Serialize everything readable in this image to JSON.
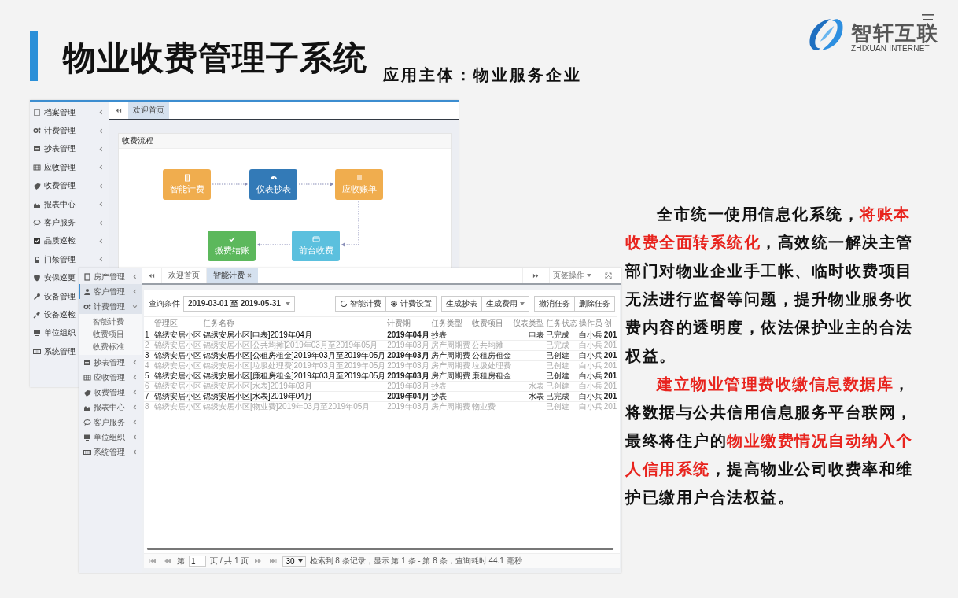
{
  "slide": {
    "title": "物业收费管理子系统",
    "subtitle": "应用主体：物业服务企业"
  },
  "logo": {
    "name": "智轩互联",
    "tagline": "ZHIXUAN INTERNET"
  },
  "screenshot_1": {
    "sidebar": [
      {
        "label": "档案管理",
        "chevron": true
      },
      {
        "label": "计费管理",
        "chevron": true
      },
      {
        "label": "抄表管理",
        "chevron": true
      },
      {
        "label": "应收管理",
        "chevron": true
      },
      {
        "label": "收费管理",
        "chevron": true
      },
      {
        "label": "报表中心",
        "chevron": true
      },
      {
        "label": "客户服务",
        "chevron": true
      },
      {
        "label": "品质巡检",
        "chevron": true
      },
      {
        "label": "门禁管理",
        "chevron": true
      },
      {
        "label": "安保巡更",
        "chevron": false
      },
      {
        "label": "设备管理",
        "chevron": false
      },
      {
        "label": "设备巡检",
        "chevron": false
      },
      {
        "label": "单位组织",
        "chevron": false
      },
      {
        "label": "系统管理",
        "chevron": false
      }
    ],
    "tabs": [
      {
        "label": "欢迎首页",
        "selected": true
      }
    ],
    "panel": {
      "title": "收费流程",
      "steps": [
        {
          "label": "智能计费",
          "color": "#f0ad4e"
        },
        {
          "label": "仪表抄表",
          "color": "#337ab7"
        },
        {
          "label": "应收账单",
          "color": "#f0ad4e"
        },
        {
          "label": "前台收费",
          "color": "#5bc0de"
        },
        {
          "label": "缴费结账",
          "color": "#5cb85c"
        }
      ]
    }
  },
  "screenshot_2": {
    "sidebar": [
      {
        "label": "房产管理",
        "selected": false,
        "expanded": false
      },
      {
        "label": "客户管理",
        "selected": true,
        "expanded": false
      },
      {
        "label": "计费管理",
        "selected": false,
        "expanded": true,
        "children": [
          {
            "label": "智能计费"
          },
          {
            "label": "收费项目"
          },
          {
            "label": "收费标准"
          }
        ]
      },
      {
        "label": "抄表管理",
        "selected": false,
        "expanded": false
      },
      {
        "label": "应收管理",
        "selected": false,
        "expanded": false
      },
      {
        "label": "收费管理",
        "selected": false,
        "expanded": false
      },
      {
        "label": "报表中心",
        "selected": false,
        "expanded": false
      },
      {
        "label": "客户服务",
        "selected": false,
        "expanded": false
      },
      {
        "label": "单位组织",
        "selected": false,
        "expanded": false
      },
      {
        "label": "系统管理",
        "selected": false,
        "expanded": false
      }
    ],
    "tabs": [
      {
        "label": "欢迎首页",
        "selected": false,
        "closable": false
      },
      {
        "label": "智能计费",
        "selected": true,
        "closable": true
      }
    ],
    "tab_menu": "页签操作",
    "query": {
      "label": "查询条件",
      "value": "2019-03-01 至 2019-05-31"
    },
    "toolbar": [
      [
        {
          "label": "智能计费",
          "dropdown": false
        },
        {
          "label": "计费设置",
          "dropdown": false
        }
      ],
      [
        {
          "label": "生成抄表",
          "dropdown": false
        },
        {
          "label": "生成费用",
          "dropdown": true
        }
      ],
      [
        {
          "label": "撤消任务",
          "dropdown": false
        },
        {
          "label": "删除任务",
          "dropdown": false
        }
      ]
    ],
    "table": {
      "columns": [
        "管理区",
        "任务名称",
        "计费期",
        "任务类型",
        "收费项目",
        "仪表类型",
        "任务状态",
        "操作员",
        "创"
      ],
      "rows": [
        {
          "no": "1",
          "emphasized": true,
          "cells": [
            "锦绣安居小区",
            "锦绣安居小区[电表]2019年04月",
            "2019年04月",
            "抄表",
            "",
            "电表",
            "已完成",
            "白小兵",
            "201"
          ]
        },
        {
          "no": "2",
          "emphasized": false,
          "cells": [
            "锦绣安居小区",
            "锦绣安居小区[公共均摊]2019年03月至2019年05月",
            "2019年03月",
            "房产周期费",
            "公共均摊",
            "",
            "已完成",
            "白小兵",
            "201"
          ]
        },
        {
          "no": "3",
          "emphasized": true,
          "cells": [
            "锦绣安居小区",
            "锦绣安居小区[公租房租金]2019年03月至2019年05月",
            "2019年03月",
            "房产周期费",
            "公租房租金",
            "",
            "已创建",
            "白小兵",
            "201"
          ]
        },
        {
          "no": "4",
          "emphasized": false,
          "cells": [
            "锦绣安居小区",
            "锦绣安居小区[垃圾处理费]2019年03月至2019年05月",
            "2019年03月",
            "房产周期费",
            "垃圾处理费",
            "",
            "已创建",
            "白小兵",
            "201"
          ]
        },
        {
          "no": "5",
          "emphasized": true,
          "cells": [
            "锦绣安居小区",
            "锦绣安居小区[廉租房租金]2019年03月至2019年05月",
            "2019年03月",
            "房产周期费",
            "廉租房租金",
            "",
            "已创建",
            "白小兵",
            "201"
          ]
        },
        {
          "no": "6",
          "emphasized": false,
          "cells": [
            "锦绣安居小区",
            "锦绣安居小区[水表]2019年03月",
            "2019年03月",
            "抄表",
            "",
            "水表",
            "已创建",
            "白小兵",
            "201"
          ]
        },
        {
          "no": "7",
          "emphasized": true,
          "cells": [
            "锦绣安居小区",
            "锦绣安居小区[水表]2019年04月",
            "2019年04月",
            "抄表",
            "",
            "水表",
            "已完成",
            "白小兵",
            "201"
          ]
        },
        {
          "no": "8",
          "emphasized": false,
          "cells": [
            "锦绣安居小区",
            "锦绣安居小区[物业费]2019年03月至2019年05月",
            "2019年03月",
            "房产周期费",
            "物业费",
            "",
            "已创建",
            "白小兵",
            "201"
          ]
        }
      ]
    },
    "pager": {
      "page_prefix": "第",
      "page": "1",
      "page_suffix": "页 / 共 1 页",
      "page_size": "30",
      "info": "检索到 8 条记录，显示 第 1 条 - 第 8 条，查询耗时 44.1 毫秒"
    }
  },
  "paragraphs": [
    {
      "segments": [
        {
          "text": "全市统一使用信息化系统，",
          "highlight": false
        },
        {
          "text": "将账本收费全面转系统化",
          "highlight": true
        },
        {
          "text": "，高效统一解决主管部门对物业企业手工帐、临时收费项目无法进行监督等问题，提升物业服务收费内容的透明度，依法保护业主的合法权益。",
          "highlight": false
        }
      ]
    },
    {
      "segments": [
        {
          "text": "建立物业管理费收缴信息数据库",
          "highlight": true
        },
        {
          "text": "，将数据与公共信用信息服务平台联网，最终将住户的",
          "highlight": false
        },
        {
          "text": "物业缴费情况自动纳入个人信用系统",
          "highlight": true
        },
        {
          "text": "，提高物业公司收费率和维护已缴用户合法权益。",
          "highlight": false
        }
      ]
    }
  ]
}
